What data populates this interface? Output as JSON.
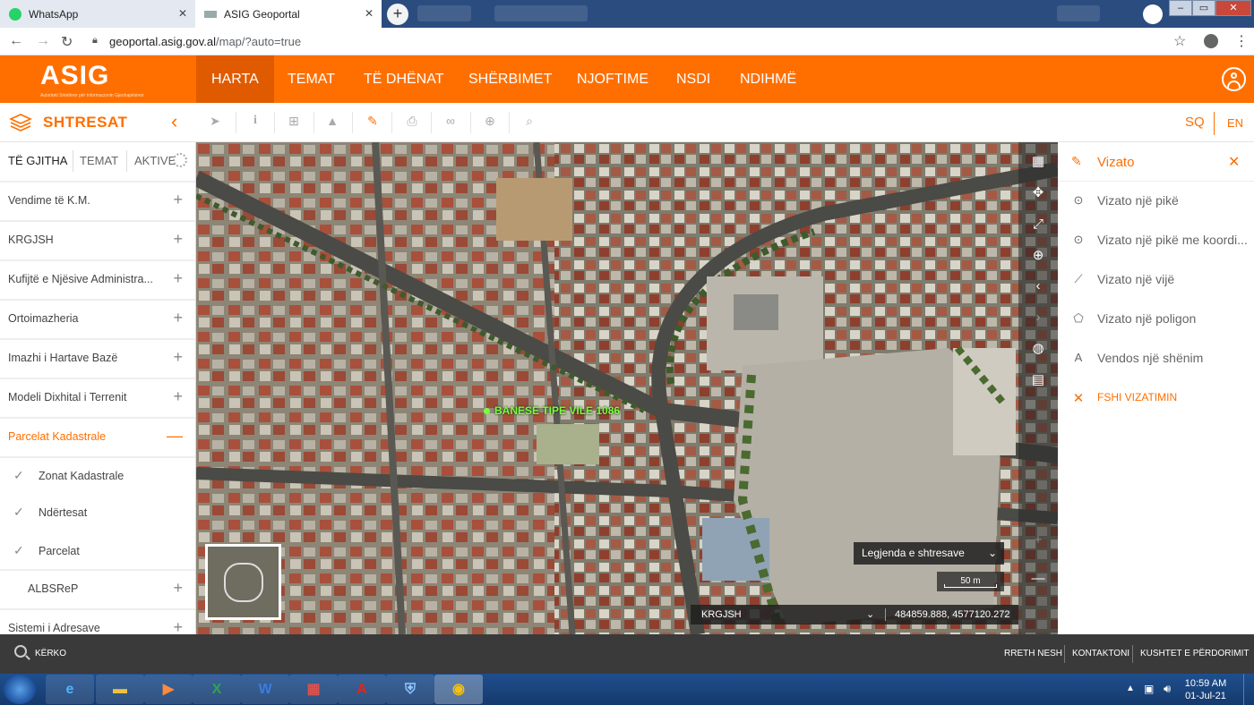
{
  "browser": {
    "tabs": [
      {
        "label": "WhatsApp",
        "close": "✕"
      },
      {
        "label": "ASIG Geoportal",
        "close": "✕"
      }
    ],
    "new_tab": "+",
    "url_host": "geoportal.asig.gov.al",
    "url_path": "/map/?auto=true"
  },
  "header": {
    "logo": "ASIG",
    "logo_tagline": "Autoriteti Shtetëror për Informacionin Gjeohapësinor",
    "nav": [
      "HARTA",
      "TEMAT",
      "TË DHËNAT",
      "SHËRBIMET",
      "NJOFTIME",
      "NSDI",
      "NDIHMË"
    ]
  },
  "toolbar": {
    "layers_title": "SHTRESAT",
    "collapse_icon": "‹",
    "lang_sq": "SQ",
    "lang_en": "EN"
  },
  "left_panel": {
    "tabs": [
      "TË GJITHA",
      "TEMAT",
      "AKTIVE"
    ],
    "items": [
      {
        "label": "Vendime të K.M.",
        "toggle": "+"
      },
      {
        "label": "KRGJSH",
        "toggle": "+"
      },
      {
        "label": "Kufijtë e Njësive Administra...",
        "toggle": "+"
      },
      {
        "label": "Ortoimazheria",
        "toggle": "+"
      },
      {
        "label": "Imazhi i Hartave Bazë",
        "toggle": "+"
      },
      {
        "label": "Modeli Dixhital i Terrenit",
        "toggle": "+"
      },
      {
        "label": "Parcelat Kadastrale",
        "toggle": "—"
      }
    ],
    "subitems": [
      {
        "label": "Zonat Kadastrale",
        "check": "✓"
      },
      {
        "label": "Ndërtesat",
        "check": "✓"
      },
      {
        "label": "Parcelat",
        "check": "✓"
      }
    ],
    "more_items": [
      {
        "label": "ALBSReP",
        "toggle": "+"
      },
      {
        "label": "Sistemi i Adresave",
        "toggle": "+"
      }
    ]
  },
  "map": {
    "feature_label": "BANESE TIPE VILE 1086",
    "legend_label": "Legjenda e shtresave",
    "scale_label": "50 m",
    "crs": "KRGJSH",
    "coordinates": "484859.888, 4577120.272",
    "zoom_in": "+",
    "zoom_out": "—"
  },
  "draw_panel": {
    "title": "Vizato",
    "close": "✕",
    "items": [
      {
        "label": "Vizato një pikë",
        "icon": "point-icon"
      },
      {
        "label": "Vizato një pikë me koordi...",
        "icon": "point-coords-icon"
      },
      {
        "label": "Vizato një vijë",
        "icon": "line-icon"
      },
      {
        "label": "Vizato një poligon",
        "icon": "polygon-icon"
      },
      {
        "label": "Vendos një shënim",
        "icon": "text-icon"
      }
    ],
    "clear_label": "FSHI VIZATIMIN"
  },
  "footer": {
    "search": "KËRKO",
    "links": [
      "RRETH NESH",
      "KONTAKTONI",
      "KUSHTET E PËRDORIMIT"
    ]
  },
  "taskbar": {
    "time": "10:59 AM",
    "date": "01-Jul-21"
  },
  "colors": {
    "brand_orange": "#ff6f00",
    "nav_active": "#e05b00",
    "footer_bg": "#3a3a3a",
    "map_label_green": "#7cff3a"
  }
}
